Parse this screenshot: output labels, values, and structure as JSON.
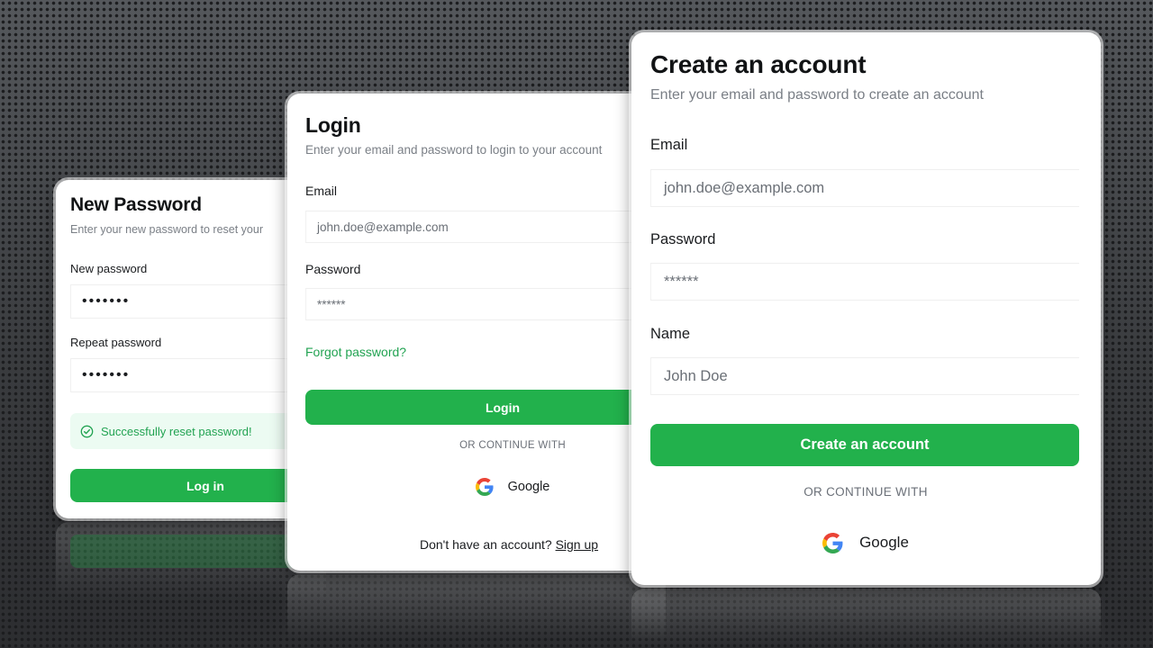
{
  "new_password_card": {
    "title": "New Password",
    "subtitle": "Enter your new password to reset your",
    "new_password_label": "New password",
    "new_password_value": "•••••••",
    "repeat_password_label": "Repeat password",
    "repeat_password_value": "•••••••",
    "success_message": "Successfully reset password!",
    "login_button": "Log in"
  },
  "login_card": {
    "title": "Login",
    "subtitle": "Enter your email and password to login to your account",
    "email_label": "Email",
    "email_placeholder": "john.doe@example.com",
    "password_label": "Password",
    "password_value": "******",
    "forgot_password": "Forgot password?",
    "login_button": "Login",
    "divider": "OR CONTINUE WITH",
    "google_button": "Google",
    "no_account_text": "Don't have an account?",
    "signup_link": "Sign up"
  },
  "create_account_card": {
    "title": "Create an account",
    "subtitle": "Enter your email and password to create an account",
    "email_label": "Email",
    "email_placeholder": "john.doe@example.com",
    "password_label": "Password",
    "password_value": "******",
    "name_label": "Name",
    "name_placeholder": "John Doe",
    "create_button": "Create an account",
    "divider": "OR CONTINUE WITH",
    "google_button": "Google"
  },
  "colors": {
    "accent": "#22b14c",
    "success_bg": "#ecfbf2",
    "success_text": "#22a352",
    "background": "#3b3d40"
  }
}
